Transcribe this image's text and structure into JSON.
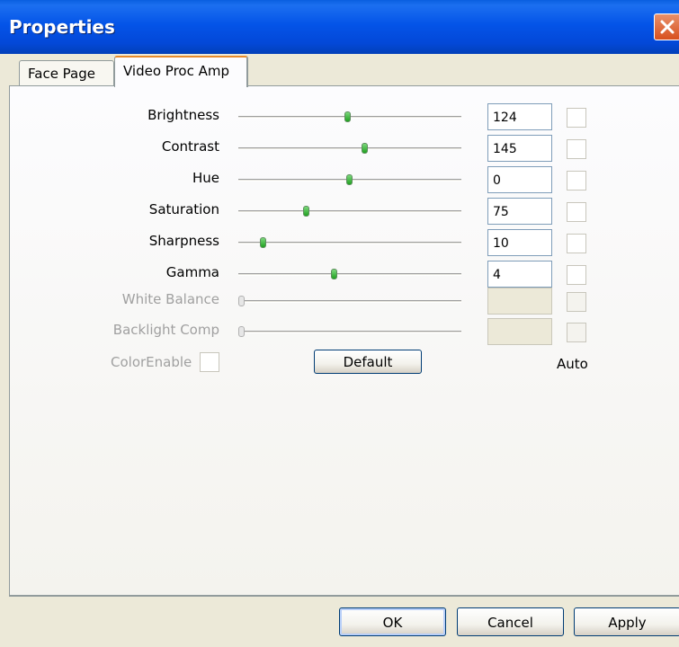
{
  "window": {
    "title": "Properties"
  },
  "tabs": [
    {
      "label": "Face Page",
      "active": false
    },
    {
      "label": "Video Proc Amp",
      "active": true
    }
  ],
  "controls": [
    {
      "label": "Brightness",
      "value": "124",
      "slider_fraction": 0.49,
      "enabled": true,
      "auto": false
    },
    {
      "label": "Contrast",
      "value": "145",
      "slider_fraction": 0.57,
      "enabled": true,
      "auto": false
    },
    {
      "label": "Hue",
      "value": "0",
      "slider_fraction": 0.5,
      "enabled": true,
      "auto": false
    },
    {
      "label": "Saturation",
      "value": "75",
      "slider_fraction": 0.3,
      "enabled": true,
      "auto": false
    },
    {
      "label": "Sharpness",
      "value": "10",
      "slider_fraction": 0.1,
      "enabled": true,
      "auto": false
    },
    {
      "label": "Gamma",
      "value": "4",
      "slider_fraction": 0.43,
      "enabled": true,
      "auto": false
    },
    {
      "label": "White Balance",
      "value": "",
      "slider_fraction": 0.0,
      "enabled": false,
      "auto": false
    },
    {
      "label": "Backlight Comp",
      "value": "",
      "slider_fraction": 0.0,
      "enabled": false,
      "auto": false
    }
  ],
  "color_enable": {
    "label": "ColorEnable",
    "checked": false,
    "enabled": false
  },
  "default_button": {
    "label": "Default"
  },
  "auto_label": "Auto",
  "footer": {
    "ok_label": "OK",
    "cancel_label": "Cancel",
    "apply_label": "Apply"
  },
  "colors": {
    "titlebar": "#0454E8",
    "close": "#D8501E",
    "active_tab_highlight": "#E68B2C",
    "thumb": "#21A121"
  }
}
